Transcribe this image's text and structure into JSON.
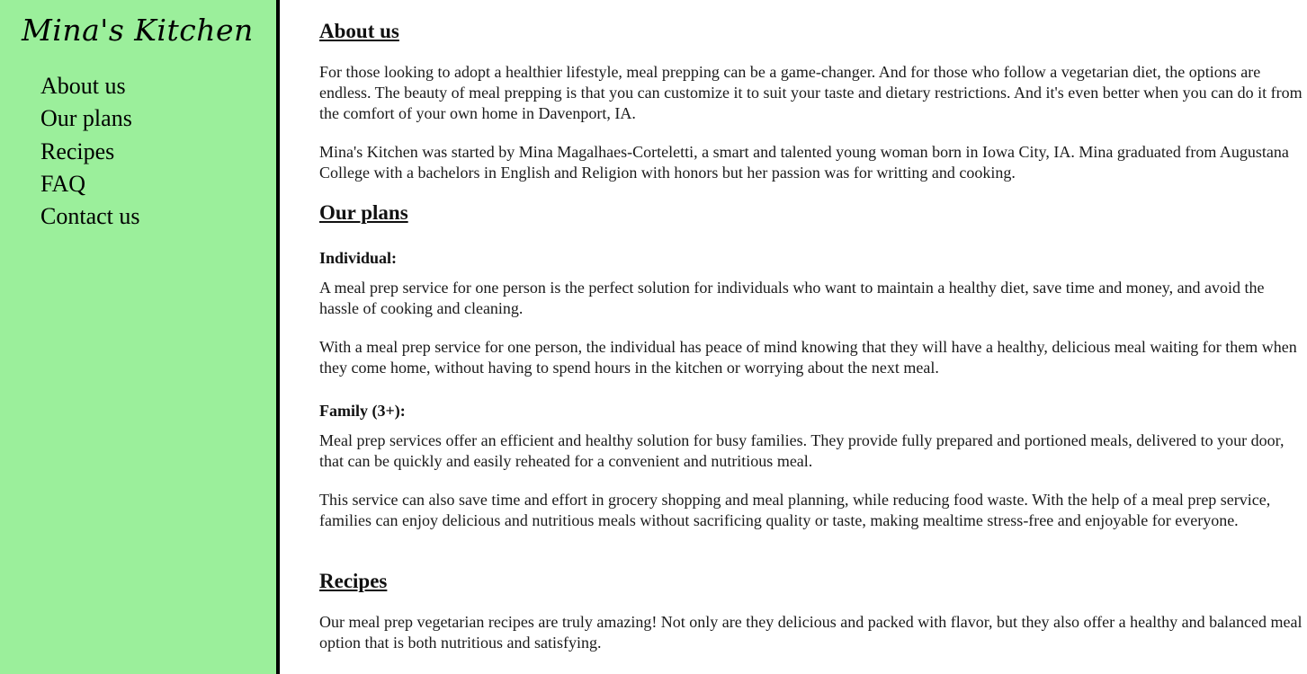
{
  "sidebar": {
    "brand": "Mina's Kitchen",
    "nav": [
      {
        "label": "About us"
      },
      {
        "label": "Our plans"
      },
      {
        "label": "Recipes"
      },
      {
        "label": "FAQ"
      },
      {
        "label": "Contact us"
      }
    ]
  },
  "about": {
    "heading": "About us",
    "p1": "For those looking to adopt a healthier lifestyle, meal prepping can be a game-changer. And for those who follow a vegetarian diet, the options are endless. The beauty of meal prepping is that you can customize it to suit your taste and dietary restrictions. And it's even better when you can do it from the comfort of your own home in Davenport, IA.",
    "p2": "Mina's Kitchen was started by Mina Magalhaes-Corteletti, a smart and talented young woman born in Iowa City, IA. Mina graduated from Augustana College with a bachelors in English and Religion with honors but her passion was for writting and cooking."
  },
  "plans": {
    "heading": "Our plans",
    "individual": {
      "title": "Individual:",
      "p1": "A meal prep service for one person is the perfect solution for individuals who want to maintain a healthy diet, save time and money, and avoid the hassle of cooking and cleaning.",
      "p2": "With a meal prep service for one person, the individual has peace of mind knowing that they will have a healthy, delicious meal waiting for them when they come home, without having to spend hours in the kitchen or worrying about the next meal."
    },
    "family": {
      "title": "Family (3+):",
      "p1": "Meal prep services offer an efficient and healthy solution for busy families. They provide fully prepared and portioned meals, delivered to your door, that can be quickly and easily reheated for a convenient and nutritious meal.",
      "p2": "This service can also save time and effort in grocery shopping and meal planning, while reducing food waste. With the help of a meal prep service, families can enjoy delicious and nutritious meals without sacrificing quality or taste, making mealtime stress-free and enjoyable for everyone."
    }
  },
  "recipes": {
    "heading": "Recipes",
    "p1": "Our meal prep vegetarian recipes are truly amazing! Not only are they delicious and packed with flavor, but they also offer a healthy and balanced meal option that is both nutritious and satisfying."
  }
}
